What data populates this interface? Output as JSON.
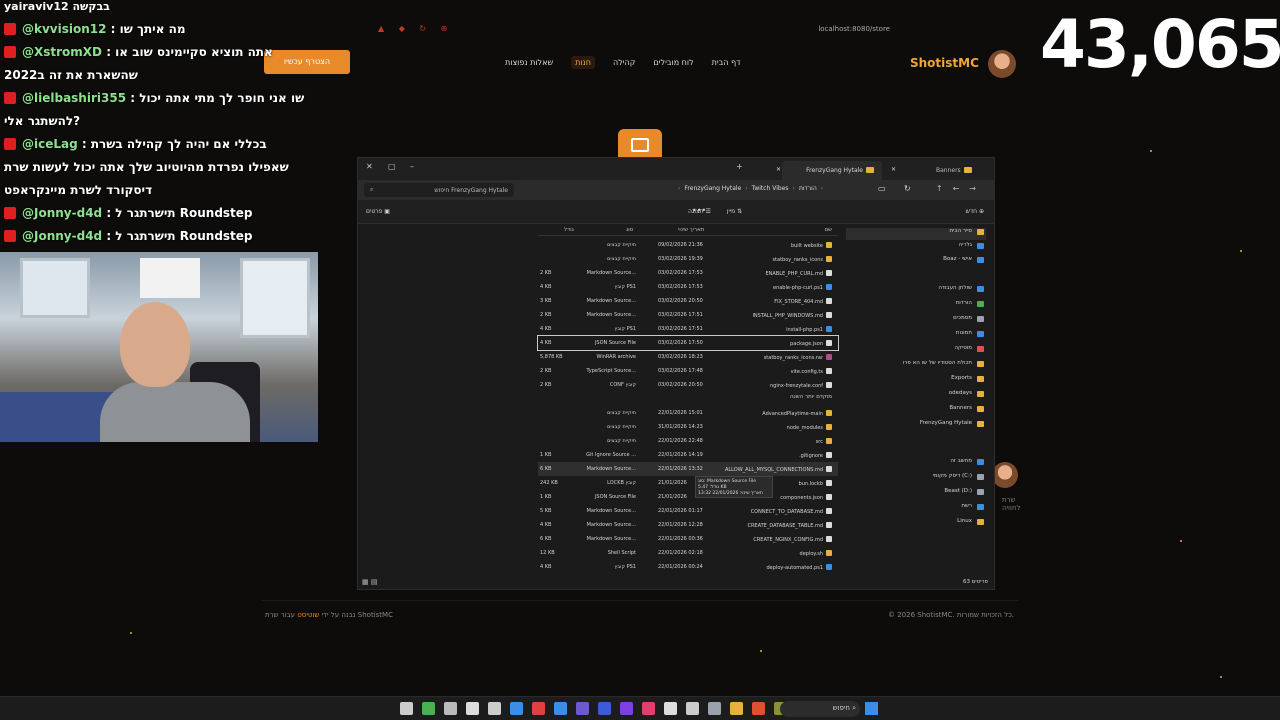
{
  "stream": {
    "viewer_count": "43,065",
    "top_text": "yairaviv12 בבקשה",
    "chat": [
      {
        "user": "@kvvision12",
        "text": " : מה איתך שו"
      },
      {
        "user": "@XstromXD",
        "text": " : אתה תוציא סקיימינס שוב או"
      },
      {
        "user": "",
        "text": "שהשארת את זה ב2022"
      },
      {
        "user": "@lielbashiri355",
        "text": " : שו אני חופר לך מתי אתה יכול"
      },
      {
        "user": "",
        "text": "להשתגר אלי?"
      },
      {
        "user": "@iceLag",
        "text": " : בכללי אם יהיה לך קהילה בשרת"
      },
      {
        "user": "",
        "text": "שאפילו נפרדת מהיוטיוב שלך אתה יכול לעשות שרת"
      },
      {
        "user": "",
        "text": "דיסקורד לשרת מיינקראפט"
      },
      {
        "user": "@Jonny-d4d",
        "text": " : תישרתגר ל Roundstep"
      },
      {
        "user": "@Jonny-d4d",
        "text": " : תישרתגר ל Roundstep"
      }
    ]
  },
  "browser": {
    "url": "localhost:8080/store"
  },
  "site": {
    "brand": "ShotistMC",
    "nav": [
      "דף הבית",
      "לוח מובילים",
      "קהילה",
      "חנות",
      "שאלות נפוצות"
    ],
    "active_nav": "חנות",
    "join_button": "הצטרף עכשיו",
    "footer_left_prefix": "נבנה על ידי",
    "footer_left_link": "שוטיסט",
    "footer_left_suffix": "עבור שרת ShotistMC",
    "footer_right": "© 2026 ShotistMC. כל הזכויות שמורות.",
    "side_text": "שרת לחוויה"
  },
  "explorer": {
    "tabs": {
      "active": "FrenzyGang Hytale",
      "other": "Banners"
    },
    "search_placeholder": "חיפוש FrenzyGang Hytale",
    "breadcrumb": [
      "הורדות",
      "Twitch Vibes",
      "FrenzyGang Hytale"
    ],
    "commands": {
      "new": "חדש",
      "sort": "מיין",
      "view": "תצוגה",
      "details": "פרטים",
      "more": "•••"
    },
    "columns": {
      "name": "שם",
      "date": "תאריך שינוי",
      "type": "סוג",
      "size": "גודל"
    },
    "sidebar": [
      {
        "label": "סייר הבית",
        "color": "#e8b23a",
        "selected": true
      },
      {
        "label": "גלריה",
        "color": "#3b8ee6"
      },
      {
        "label": "Boaz - אישי",
        "color": "#3b8ee6"
      },
      {
        "label": "שולחן העבודה",
        "color": "#3b8ee6"
      },
      {
        "label": "הורדות",
        "color": "#4caf50"
      },
      {
        "label": "מסמכים",
        "color": "#9aa3ad"
      },
      {
        "label": "תמונות",
        "color": "#3b8ee6"
      },
      {
        "label": "מוסיקה",
        "color": "#e05050"
      },
      {
        "label": "תכולת הסטודיו של שו הא פרו",
        "color": "#e8b23a"
      },
      {
        "label": "Exports",
        "color": "#e8b23a"
      },
      {
        "label": "odedays",
        "color": "#e8b23a"
      },
      {
        "label": "Banners",
        "color": "#e8b23a"
      },
      {
        "label": "FrenzyGang Hytale",
        "color": "#e8b23a"
      },
      {
        "label": "מחשב זה",
        "color": "#3b8ee6"
      },
      {
        "label": "דיסק מקומי (C:)",
        "color": "#9aa3ad"
      },
      {
        "label": "Beast (D:)",
        "color": "#9aa3ad"
      },
      {
        "label": "רשת",
        "color": "#3b8ee6"
      },
      {
        "label": "Linux",
        "color": "#e8b23a"
      }
    ],
    "files_recent": [
      {
        "name": "built website",
        "date": "09/02/2026 21:36",
        "type": "תיקיית קבצים",
        "size": "",
        "icon": "#e8b23a"
      },
      {
        "name": "statboy_ranks_icons",
        "date": "03/02/2026 19:39",
        "type": "תיקיית קבצים",
        "size": "",
        "icon": "#e8b23a"
      },
      {
        "name": "ENABLE_PHP_CURL.md",
        "date": "03/02/2026 17:53",
        "type": "Markdown Source...",
        "size": "2 KB",
        "icon": "#dddddd"
      },
      {
        "name": "enable-php-curl.ps1",
        "date": "03/02/2026 17:53",
        "type": "קובץ PS1",
        "size": "4 KB",
        "icon": "#3b8ee6"
      },
      {
        "name": "FIX_STORE_404.md",
        "date": "03/02/2026 20:50",
        "type": "Markdown Source...",
        "size": "3 KB",
        "icon": "#dddddd"
      },
      {
        "name": "INSTALL_PHP_WINDOWS.md",
        "date": "03/02/2026 17:51",
        "type": "Markdown Source...",
        "size": "2 KB",
        "icon": "#dddddd"
      },
      {
        "name": "install-php.ps1",
        "date": "03/02/2026 17:51",
        "type": "קובץ PS1",
        "size": "4 KB",
        "icon": "#3b8ee6"
      },
      {
        "name": "package.json",
        "date": "03/02/2026 17:50",
        "type": "JSON Source File",
        "size": "4 KB",
        "icon": "#dddddd",
        "boxed": true
      },
      {
        "name": "statboy_ranks_icons.rar",
        "date": "03/02/2026 18:23",
        "type": "WinRAR archive",
        "size": "5,878 KB",
        "icon": "#b04a8a"
      },
      {
        "name": "vite.config.ts",
        "date": "03/02/2026 17:48",
        "type": "TypeScript Source...",
        "size": "2 KB",
        "icon": "#dddddd"
      },
      {
        "name": "nginx-frenzytale.conf",
        "date": "03/02/2026 20:50",
        "type": "CONF קובץ",
        "size": "2 KB",
        "icon": "#dddddd"
      }
    ],
    "group_header": "מוקדם יותר השנה",
    "files_earlier": [
      {
        "name": "AdvancedPlaytime-main",
        "date": "22/01/2026 15:01",
        "type": "תיקיית קבצים",
        "size": "",
        "icon": "#e8b23a"
      },
      {
        "name": "node_modules",
        "date": "31/01/2026 14:23",
        "type": "תיקיית קבצים",
        "size": "",
        "icon": "#e8b23a"
      },
      {
        "name": "src",
        "date": "22/01/2026 22:48",
        "type": "תיקיית קבצים",
        "size": "",
        "icon": "#e8b23a"
      },
      {
        "name": ".gitignore",
        "date": "22/01/2026 14:19",
        "type": "Git Ignore Source ...",
        "size": "1 KB",
        "icon": "#dddddd"
      },
      {
        "name": "ALLOW_ALL_MYSQL_CONNECTIONS.md",
        "date": "22/01/2026 13:32",
        "type": "Markdown Source...",
        "size": "6 KB",
        "icon": "#dddddd",
        "hover": true
      },
      {
        "name": "bun.lockb",
        "date": "21/01/2026",
        "type": "LOCKB קובץ",
        "size": "242 KB",
        "icon": "#dddddd"
      },
      {
        "name": "components.json",
        "date": "21/01/2026",
        "type": "JSON Source File",
        "size": "1 KB",
        "icon": "#dddddd"
      },
      {
        "name": "CONNECT_TO_DATABASE.md",
        "date": "22/01/2026 01:17",
        "type": "Markdown Source...",
        "size": "5 KB",
        "icon": "#dddddd"
      },
      {
        "name": "CREATE_DATABASE_TABLE.md",
        "date": "22/01/2026 12:28",
        "type": "Markdown Source...",
        "size": "4 KB",
        "icon": "#dddddd"
      },
      {
        "name": "CREATE_NGINX_CONFIG.md",
        "date": "22/01/2026 00:36",
        "type": "Markdown Source...",
        "size": "6 KB",
        "icon": "#dddddd"
      },
      {
        "name": "deploy.sh",
        "date": "22/01/2026 02:18",
        "type": "Shell Script",
        "size": "12 KB",
        "icon": "#e8b23a"
      },
      {
        "name": "deploy-automated.ps1",
        "date": "22/01/2026 00:24",
        "type": "קובץ PS1",
        "size": "4 KB",
        "icon": "#3b8ee6"
      }
    ],
    "tooltip": [
      "סוג: Markdown Source File",
      "גודל: 5.47 KB",
      "תאריך שינוי: 22/01/2026 13:32"
    ],
    "status_count": "63 פריטים"
  },
  "taskbar": {
    "search": "חיפוש",
    "icon_colors": [
      "#cccccc",
      "#4caf50",
      "#bbbbbb",
      "#dddddd",
      "#cccccc",
      "#3b8ee6",
      "#e04040",
      "#3b8ee6",
      "#6a5acd",
      "#3b5bdb",
      "#7b3fe4",
      "#e04070",
      "#dddddd",
      "#cccccc",
      "#9aa3ad",
      "#e8b23a",
      "#e05030",
      "#8a8f3a"
    ]
  }
}
